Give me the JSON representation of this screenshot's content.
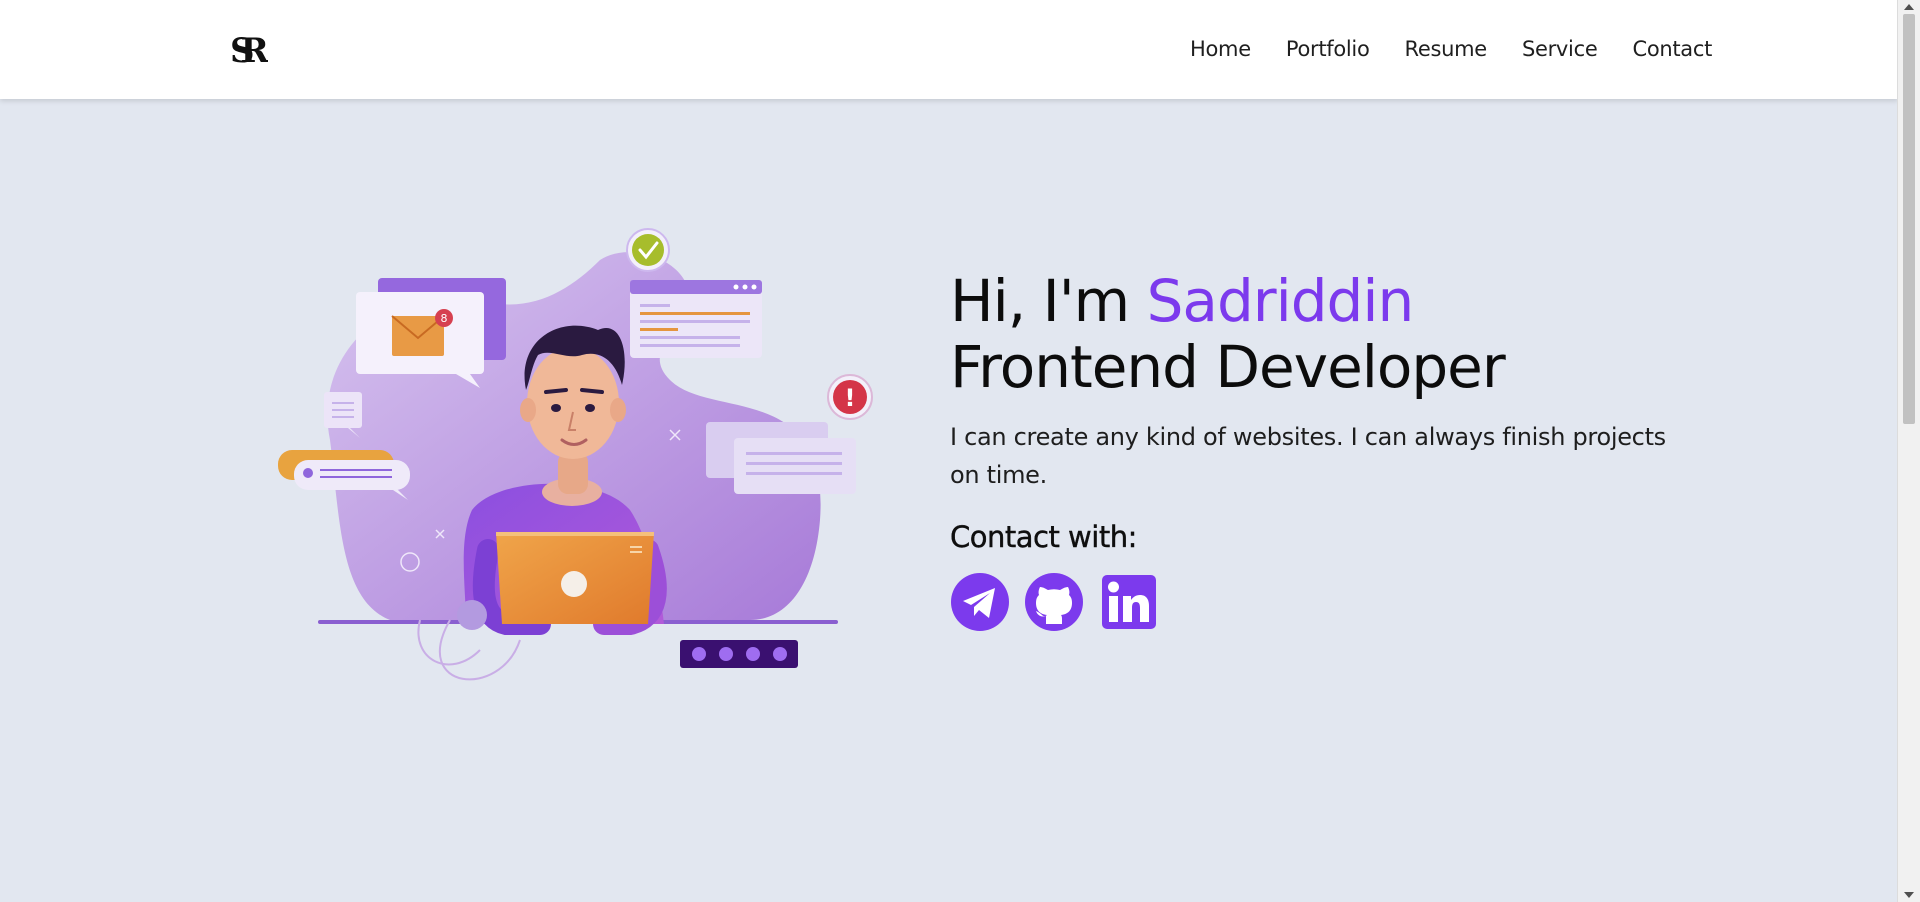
{
  "header": {
    "logo_text": "SR",
    "nav": [
      {
        "label": "Home"
      },
      {
        "label": "Portfolio"
      },
      {
        "label": "Resume"
      },
      {
        "label": "Service"
      },
      {
        "label": "Contact"
      }
    ]
  },
  "hero": {
    "greeting": "Hi, I'm ",
    "name": "Sadriddin",
    "role": "Frontend Developer",
    "description": "I can create any kind of websites. I can always finish projects on time.",
    "contact_title": "Contact with:",
    "socials": [
      {
        "icon": "telegram-icon"
      },
      {
        "icon": "github-icon"
      },
      {
        "icon": "linkedin-icon"
      }
    ],
    "illustration": {
      "mail_badge": "8",
      "alert_mark": "!"
    }
  },
  "colors": {
    "accent": "#7c3aed",
    "background": "#e2e7f0",
    "header_bg": "#ffffff"
  }
}
